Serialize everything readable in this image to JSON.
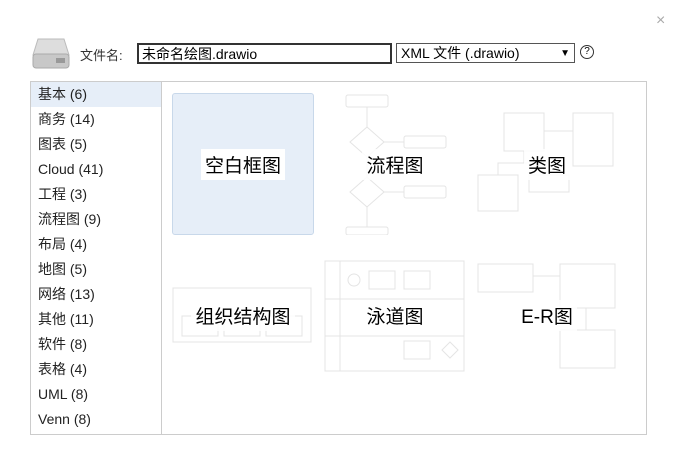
{
  "dialog": {
    "close_icon": "×"
  },
  "file": {
    "label": "文件名:",
    "value": "未命名绘图.drawio",
    "type": "XML 文件 (.drawio)",
    "help": "?"
  },
  "categories": [
    {
      "label": "基本 (6)"
    },
    {
      "label": "商务 (14)"
    },
    {
      "label": "图表 (5)"
    },
    {
      "label": "Cloud (41)"
    },
    {
      "label": "工程 (3)"
    },
    {
      "label": "流程图 (9)"
    },
    {
      "label": "布局 (4)"
    },
    {
      "label": "地图 (5)"
    },
    {
      "label": "网络 (13)"
    },
    {
      "label": "其他 (11)"
    },
    {
      "label": "软件 (8)"
    },
    {
      "label": "表格 (4)"
    },
    {
      "label": "UML (8)"
    },
    {
      "label": "Venn (8)"
    }
  ],
  "templates": [
    {
      "label": "空白框图"
    },
    {
      "label": "流程图"
    },
    {
      "label": "类图"
    },
    {
      "label": "组织结构图"
    },
    {
      "label": "泳道图"
    },
    {
      "label": "E-R图"
    }
  ]
}
